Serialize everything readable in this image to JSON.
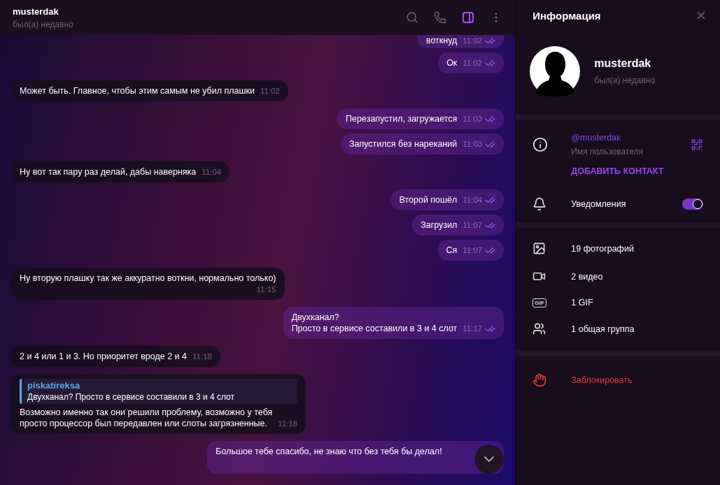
{
  "chat": {
    "name": "musterdak",
    "status": "был(а) недавно",
    "messages": [
      {
        "kind": "out",
        "text": "воткнуд",
        "time": "11:02",
        "read": true,
        "cut": true
      },
      {
        "kind": "out",
        "text": "Ок",
        "time": "11:02",
        "read": true
      },
      {
        "kind": "in",
        "text": "Может быть. Главное, чтобы этим самым не убил плашки",
        "time": "11:02"
      },
      {
        "kind": "out",
        "text": "Перезапустил, загружается",
        "time": "11:03",
        "read": true
      },
      {
        "kind": "out",
        "text": "Запустился без нареканий",
        "time": "11:03",
        "read": true
      },
      {
        "kind": "in",
        "text": "Ну вот так пару раз делай, дабы наверняка",
        "time": "11:04"
      },
      {
        "kind": "out",
        "text": "Второй пошёл",
        "time": "11:04",
        "read": true
      },
      {
        "kind": "out",
        "text": "Загрузил",
        "time": "11:07",
        "read": true
      },
      {
        "kind": "out",
        "text": "Ся",
        "time": "11:07",
        "read": true
      },
      {
        "kind": "in",
        "text": "Ну вторую плашку так же аккуратно воткни, нормально только)",
        "time": "11:15",
        "wide": true
      },
      {
        "kind": "out",
        "text": "Двухканал?\nПросто в сервисе составили в 3 и 4 слот",
        "time": "11:17",
        "read": true
      },
      {
        "kind": "in",
        "text": "2 и 4 или 1 и 3. Но приоритет вроде 2 и 4",
        "time": "11:18"
      },
      {
        "kind": "reply",
        "author": "piskatireksa",
        "quote": "Двухканал?  Просто в сервисе составили в 3 и 4 слот",
        "text": "Возможно именно так они решили проблему, возможно у тебя\nпросто процессор был передавлен или слоты загрязненные.",
        "time": "11:18"
      },
      {
        "kind": "out",
        "text": "Большое тебе спасибо, не знаю что без тебя бы делал!"
      }
    ]
  },
  "info": {
    "title": "Информация",
    "name": "musterdak",
    "status": "был(а) недавно",
    "username": "@musterdak",
    "username_label": "Имя пользователя",
    "add_contact": "ДОБАВИТЬ КОНТАКТ",
    "notifications": {
      "label": "Уведомления",
      "on": true
    },
    "media": [
      {
        "kind": "photo",
        "label": "19 фотографий"
      },
      {
        "kind": "video",
        "label": "2 видео"
      },
      {
        "kind": "gif",
        "icon_text": "GIF",
        "label": "1 GIF"
      },
      {
        "kind": "group",
        "label": "1 общая группа"
      }
    ],
    "block": "Заблокировать"
  }
}
